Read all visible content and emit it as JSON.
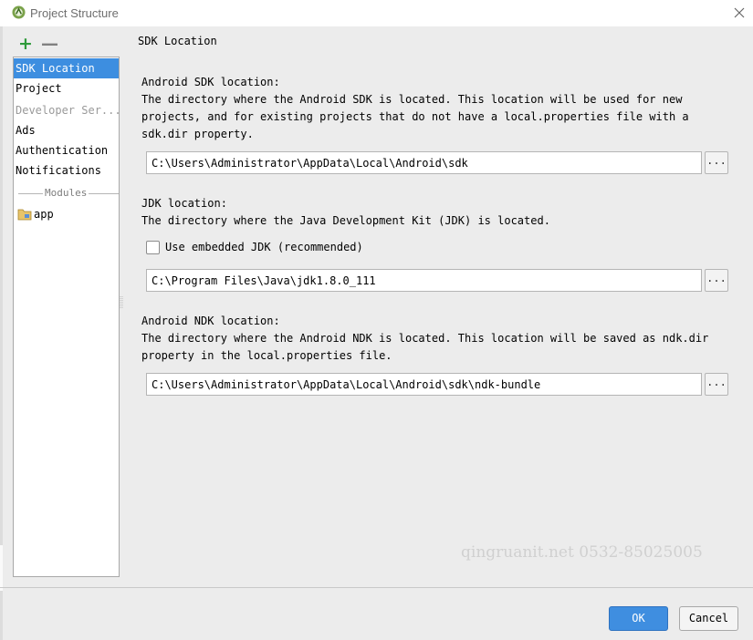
{
  "window": {
    "title": "Project Structure",
    "icon": "android-studio-icon"
  },
  "toolbar": {
    "add_icon": "+",
    "remove_icon": "—"
  },
  "sidebar": {
    "items": [
      {
        "label": "SDK Location",
        "selected": true
      },
      {
        "label": "Project"
      },
      {
        "label": "Developer Ser...",
        "disabled": true
      },
      {
        "label": "Ads"
      },
      {
        "label": "Authentication"
      },
      {
        "label": "Notifications"
      }
    ],
    "modules_header": "Modules",
    "modules": [
      {
        "label": "app",
        "icon": "module-folder-icon"
      }
    ]
  },
  "main": {
    "heading": "SDK Location",
    "android_sdk": {
      "title": "Android SDK location:",
      "description": "The directory where the Android SDK is located. This location will be used for new\nprojects, and for existing projects that do not have a local.properties file with a\nsdk.dir property.",
      "path": "C:\\Users\\Administrator\\AppData\\Local\\Android\\sdk",
      "browse_label": "..."
    },
    "jdk": {
      "title": "JDK location:",
      "description": "The directory where the Java Development Kit (JDK) is located.",
      "embedded_checkbox_label": "Use embedded JDK (recommended)",
      "embedded_checked": false,
      "path": "C:\\Program Files\\Java\\jdk1.8.0_111",
      "browse_label": "..."
    },
    "android_ndk": {
      "title": "Android NDK location:",
      "description": "The directory where the Android NDK is located. This location will be saved as ndk.dir\nproperty in the local.properties file.",
      "path": "C:\\Users\\Administrator\\AppData\\Local\\Android\\sdk\\ndk-bundle",
      "browse_label": "..."
    }
  },
  "watermark": "qingruanit.net 0532-85025005",
  "buttons": {
    "ok": "OK",
    "cancel": "Cancel"
  },
  "colors": {
    "selection": "#3d8ee0",
    "ok_button": "#3f8ee0",
    "add_icon": "#2e9a3a"
  }
}
